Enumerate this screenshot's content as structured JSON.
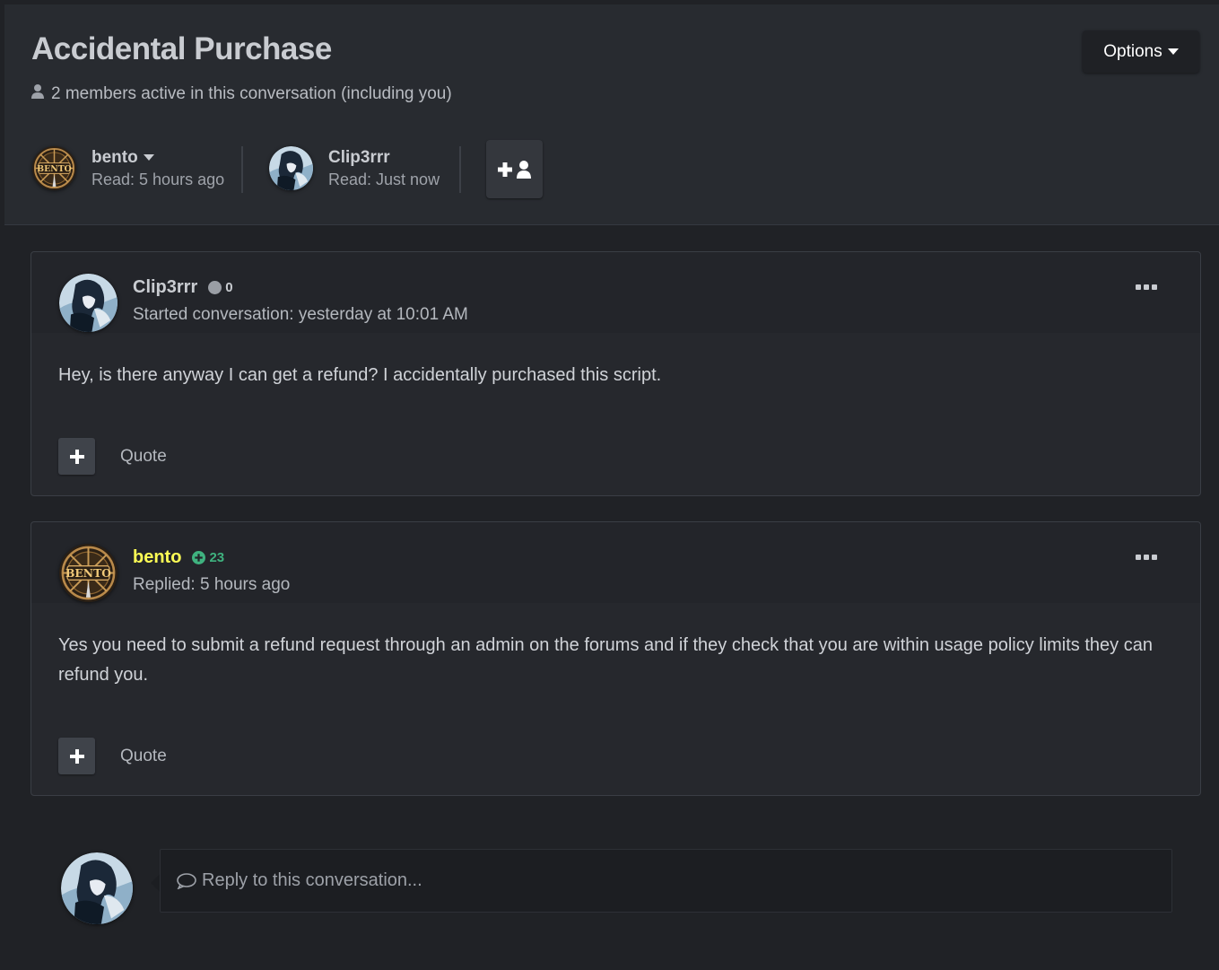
{
  "header": {
    "title": "Accidental Purchase",
    "active_text": "2 members active in this conversation (including you)",
    "options_label": "Options"
  },
  "participants": [
    {
      "name": "bento",
      "read": "Read: 5 hours ago",
      "avatar": "bento-avatar",
      "has_dropdown": true
    },
    {
      "name": "Clip3rrr",
      "read": "Read: Just now",
      "avatar": "clip3rrr-avatar",
      "has_dropdown": false
    }
  ],
  "posts": [
    {
      "author": "Clip3rrr",
      "author_color": "#c9ccd1",
      "reputation": "0",
      "reputation_color": "#c9ccd1",
      "meta": "Started conversation: yesterday at 10:01 AM",
      "body": "Hey, is there anyway I can get a refund? I accidentally purchased this script.",
      "quote_label": "Quote"
    },
    {
      "author": "bento",
      "author_color": "#ffff55",
      "reputation": "23",
      "reputation_color": "#3fb27f",
      "meta": "Replied: 5 hours ago",
      "body": "Yes you need to submit a refund request through an admin on the forums and if they check that you are within usage policy limits they can refund you.",
      "quote_label": "Quote"
    }
  ],
  "reply": {
    "placeholder": "Reply to this conversation..."
  }
}
